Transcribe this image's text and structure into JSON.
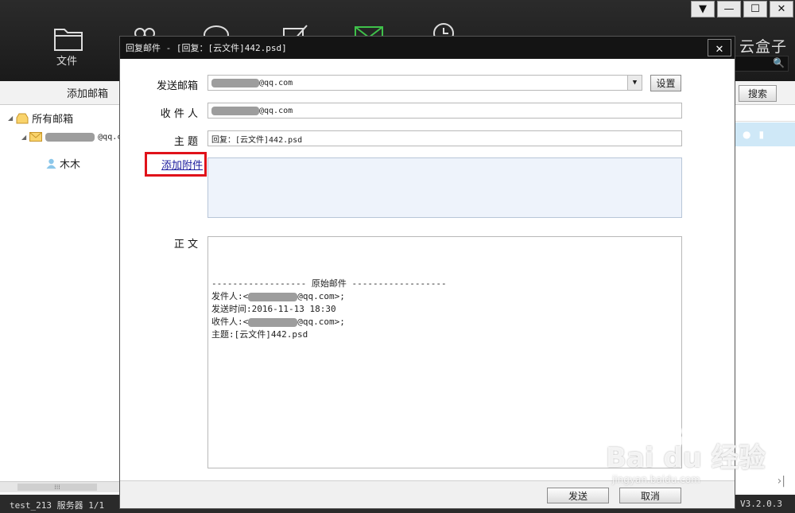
{
  "window_controls": [
    "▼",
    "—",
    "☐",
    "✕"
  ],
  "toolbar": {
    "files_label": "文件",
    "brand": "云盒子",
    "search_icon": "search-icon"
  },
  "left_panel": {
    "header": "添加邮箱",
    "all_mailboxes": "所有邮箱",
    "account_suffix": "@qq.c",
    "contact": "木木",
    "scroll_grip": "⁞⁞⁞"
  },
  "right_panel": {
    "search_button": "搜索",
    "nav_last": "›|"
  },
  "status": {
    "left": "test_213  服务器 1/1",
    "version": "V3.2.0.3"
  },
  "dialog": {
    "title": "回复邮件 - [回复：[云文件]442.psd]",
    "close": "✕",
    "from_label": "发送邮箱",
    "from_suffix": "@qq.com",
    "settings_button": "设置",
    "to_label": "收 件 人",
    "to_suffix": "@qq.com",
    "subject_label": "主  题",
    "subject_value": "回复：[云文件]442.psd",
    "attach_link": "添加附件",
    "body_label": "正  文",
    "body": {
      "separator": "------------------ 原始邮件 ------------------",
      "sender_prefix": "发件人:<",
      "sender_suffix": "@qq.com>;",
      "sent_time": "发送时间:2016-11-13 18:30",
      "recipient_prefix": "收件人:<",
      "recipient_suffix": "@qq.com>;",
      "subject": "主题:[云文件]442.psd"
    },
    "send_button": "发送",
    "cancel_button": "取消"
  },
  "watermark": {
    "main": "Bai du 经验",
    "sub": "jingyan.baidu.com"
  },
  "colors": {
    "highlight": "#e0121a",
    "attach_bg": "#eef3fb",
    "selected_row": "#cfe8f7"
  }
}
